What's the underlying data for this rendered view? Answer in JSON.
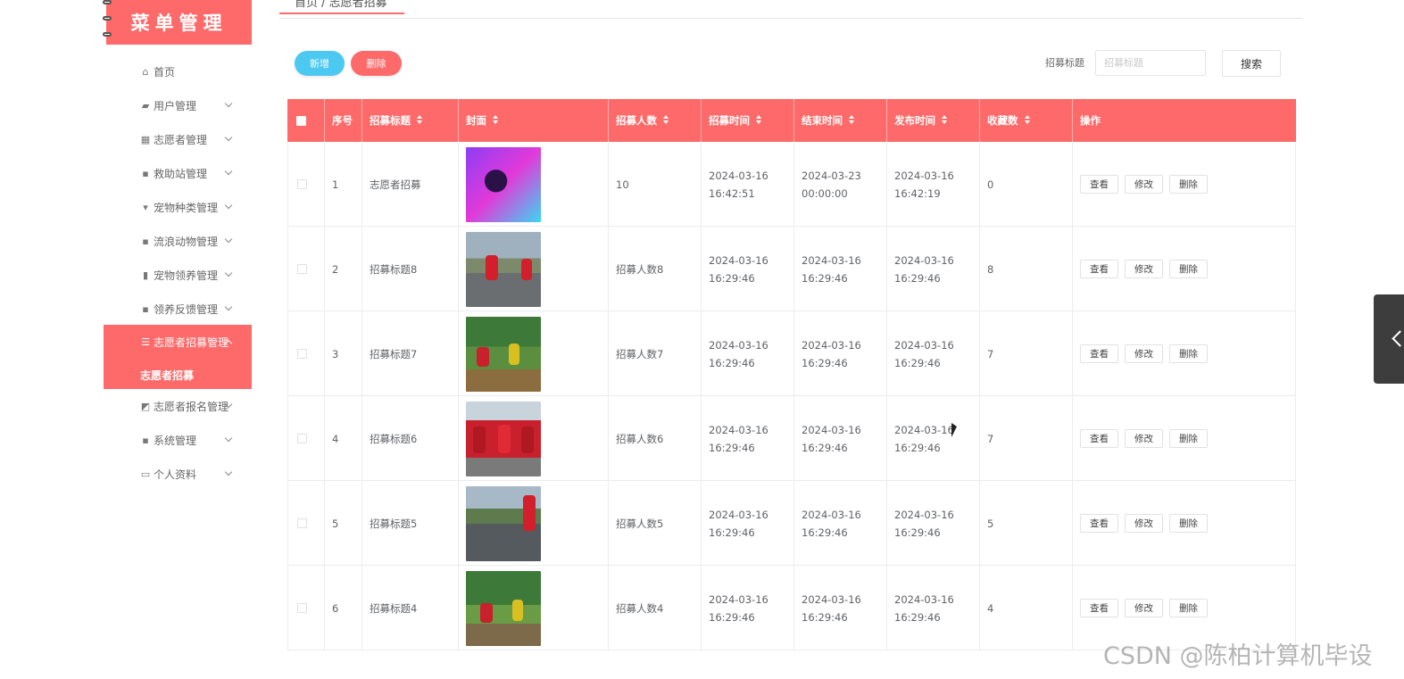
{
  "sidebar": {
    "logo": "菜单管理",
    "items": [
      {
        "label": "首页",
        "icon": "home-icon"
      },
      {
        "label": "用户管理",
        "icon": "briefcase-icon"
      },
      {
        "label": "志愿者管理",
        "icon": "grid-icon"
      },
      {
        "label": "救助站管理",
        "icon": "apps-icon"
      },
      {
        "label": "宠物种类管理",
        "icon": "brush-icon"
      },
      {
        "label": "流浪动物管理",
        "icon": "apps-icon"
      },
      {
        "label": "宠物领养管理",
        "icon": "stats-icon"
      },
      {
        "label": "领养反馈管理",
        "icon": "apps-icon"
      },
      {
        "label": "志愿者招募管理",
        "icon": "list-icon"
      },
      {
        "label": "志愿者报名管理",
        "icon": "image-icon"
      },
      {
        "label": "系统管理",
        "icon": "apps-icon"
      },
      {
        "label": "个人资料",
        "icon": "card-icon"
      }
    ],
    "active_sub": "志愿者招募"
  },
  "breadcrumb": "首页 / 志愿者招募",
  "toolbar": {
    "add_label": "新增",
    "delete_label": "删除",
    "search_label": "招募标题",
    "search_placeholder": "招募标题",
    "search_button": "搜索"
  },
  "table": {
    "headers": [
      "序号",
      "招募标题",
      "封面",
      "招募人数",
      "招募时间",
      "结束时间",
      "发布时间",
      "收藏数",
      "操作"
    ],
    "actions": [
      "查看",
      "修改",
      "删除"
    ],
    "rows": [
      {
        "index": "1",
        "title": "志愿者招募",
        "count": "10",
        "start": "2024-03-16 16:42:51",
        "end": "2024-03-23 00:00:00",
        "publish": "2024-03-16 16:42:19",
        "fav": "0"
      },
      {
        "index": "2",
        "title": "招募标题8",
        "count": "招募人数8",
        "start": "2024-03-16 16:29:46",
        "end": "2024-03-16 16:29:46",
        "publish": "2024-03-16 16:29:46",
        "fav": "8"
      },
      {
        "index": "3",
        "title": "招募标题7",
        "count": "招募人数7",
        "start": "2024-03-16 16:29:46",
        "end": "2024-03-16 16:29:46",
        "publish": "2024-03-16 16:29:46",
        "fav": "7"
      },
      {
        "index": "4",
        "title": "招募标题6",
        "count": "招募人数6",
        "start": "2024-03-16 16:29:46",
        "end": "2024-03-16 16:29:46",
        "publish": "2024-03-16 16:29:46",
        "fav": "7"
      },
      {
        "index": "5",
        "title": "招募标题5",
        "count": "招募人数5",
        "start": "2024-03-16 16:29:46",
        "end": "2024-03-16 16:29:46",
        "publish": "2024-03-16 16:29:46",
        "fav": "5"
      },
      {
        "index": "6",
        "title": "招募标题4",
        "count": "招募人数4",
        "start": "2024-03-16 16:29:46",
        "end": "2024-03-16 16:29:46",
        "publish": "2024-03-16 16:29:46",
        "fav": "4"
      }
    ]
  },
  "watermark": "CSDN @陈柏计算机毕设",
  "colors": {
    "accent": "#fe6a6a",
    "add_button": "#4cc9f0"
  }
}
